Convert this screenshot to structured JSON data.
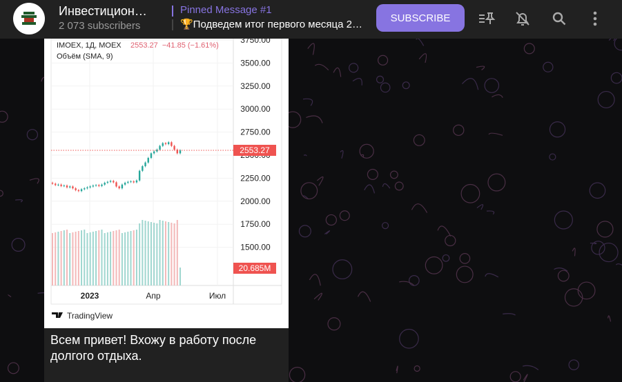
{
  "header": {
    "channel_title": "Инвестицион…",
    "subscribers": "2 073 subscribers",
    "pinned_label": "Pinned Message #1",
    "pinned_text": "🏆Подведем итог первого месяца 2…",
    "subscribe_label": "SUBSCRIBE",
    "icons": [
      "pinned-list-icon",
      "bell-off-icon",
      "search-icon",
      "more-vertical-icon"
    ]
  },
  "message": {
    "text": "Всем привет! Вхожу в работу после долгого отдыха.",
    "chart_image": {
      "symbol": "IMOEX, 1Д, MOEX",
      "quote": "2553.27  −41.85 (−1.61%)",
      "indicator": "Объём (SMA, 9)",
      "price_ticks": [
        "3750.00",
        "3500.00",
        "3250.00",
        "3000.00",
        "2750.00",
        "2500.00",
        "2250.00",
        "2000.00",
        "1750.00",
        "1500.00"
      ],
      "last_price_label": "2553.27",
      "volume_label": "20.685M",
      "date_ticks": [
        "2023",
        "Апр",
        "Июл"
      ],
      "watermark": "TradingView",
      "closes": [
        2190,
        2175,
        2180,
        2165,
        2170,
        2150,
        2160,
        2140,
        2120,
        2110,
        2130,
        2140,
        2150,
        2160,
        2170,
        2175,
        2165,
        2180,
        2200,
        2210,
        2220,
        2205,
        2160,
        2140,
        2180,
        2200,
        2210,
        2215,
        2205,
        2225,
        2330,
        2380,
        2420,
        2470,
        2520,
        2540,
        2560,
        2600,
        2630,
        2620,
        2640,
        2600,
        2560,
        2520,
        2553
      ],
      "colors": {
        "up": "#26a69a",
        "down": "#ef5350"
      }
    }
  }
}
